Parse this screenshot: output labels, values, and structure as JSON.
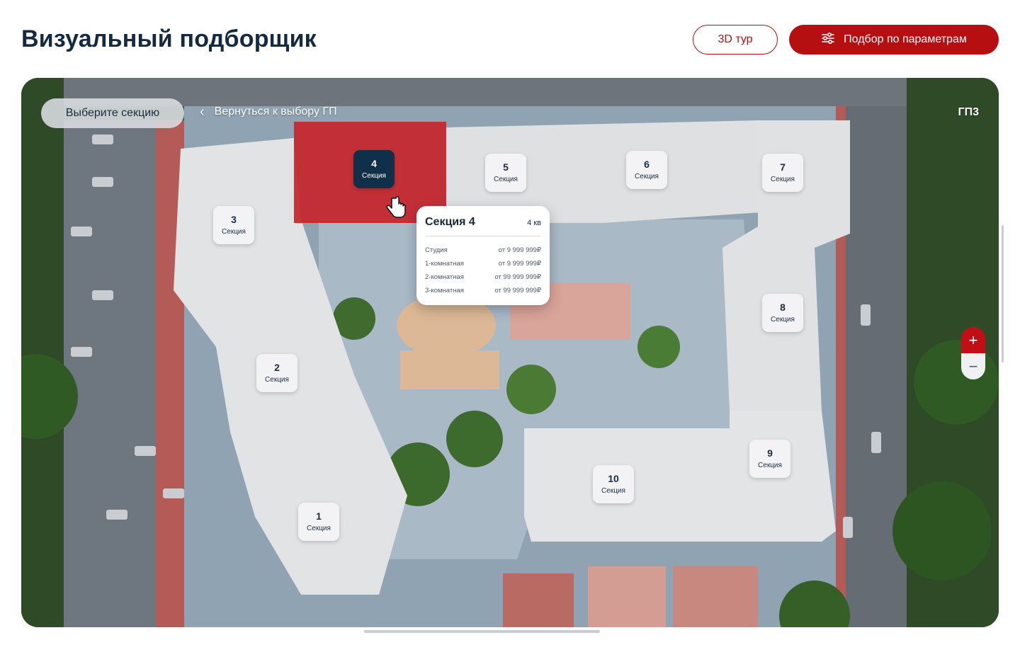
{
  "header": {
    "title": "Визуальный подборщик",
    "tour_label": "3D тур",
    "params_label": "Подбор по параметрам",
    "params_icon": "sliders-icon",
    "accent_color": "#b50f12"
  },
  "map": {
    "select_section_label": "Выберите секцию",
    "back_label": "Вернуться к выбору ГП",
    "back_icon": "chevron-left-icon",
    "building_label": "ГП3",
    "active_highlight_color": "#c7262d",
    "sections": [
      {
        "number": "1",
        "label": "Секция"
      },
      {
        "number": "2",
        "label": "Секция"
      },
      {
        "number": "3",
        "label": "Секция"
      },
      {
        "number": "4",
        "label": "Секция",
        "active": true
      },
      {
        "number": "5",
        "label": "Секция"
      },
      {
        "number": "6",
        "label": "Секция"
      },
      {
        "number": "7",
        "label": "Секция"
      },
      {
        "number": "8",
        "label": "Секция"
      },
      {
        "number": "9",
        "label": "Секция"
      },
      {
        "number": "10",
        "label": "Секция"
      }
    ],
    "tooltip": {
      "title": "Секция 4",
      "count": "4 кв",
      "rows": [
        {
          "type": "Студия",
          "price": "от 9 999 999₽"
        },
        {
          "type": "1-комнатная",
          "price": "от 9 999 999₽"
        },
        {
          "type": "2-комнатная",
          "price": "от 99 999 999₽"
        },
        {
          "type": "3-комнатная",
          "price": "от 99 999 999₽"
        }
      ]
    },
    "zoom": {
      "plus": "+",
      "minus": "−"
    }
  }
}
